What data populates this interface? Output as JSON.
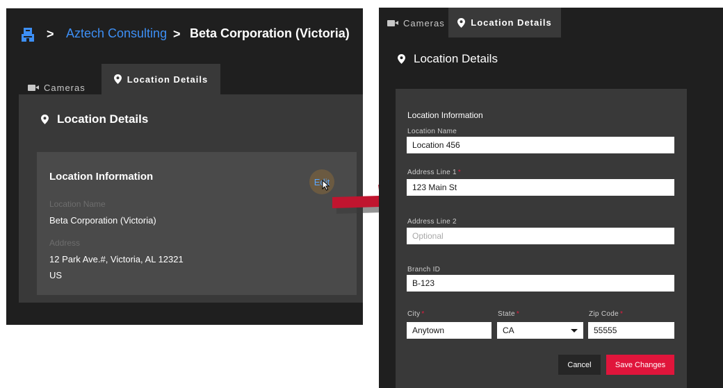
{
  "left": {
    "breadcrumb": {
      "org_icon": "building-icon",
      "separator": ">",
      "parent": "Aztech Consulting",
      "current": "Beta Corporation (Victoria)"
    },
    "tabs": [
      {
        "label": "Cameras",
        "icon": "camera-icon",
        "active": false
      },
      {
        "label": "Location Details",
        "icon": "map-pin-icon",
        "active": true
      }
    ],
    "section_title": "Location Details",
    "card": {
      "title": "Location Information",
      "edit_label": "Edit",
      "location_name_label": "Location Name",
      "location_name_value": "Beta Corporation (Victoria)",
      "address_label": "Address",
      "address_line1": "12 Park Ave.#, Victoria, AL 12321",
      "address_line2": "US"
    }
  },
  "right": {
    "tabs": [
      {
        "label": "Cameras",
        "icon": "camera-icon",
        "active": false
      },
      {
        "label": "Location Details",
        "icon": "map-pin-icon",
        "active": true
      }
    ],
    "section_title": "Location Details",
    "form": {
      "title": "Location Information",
      "location_name": {
        "label": "Location Name",
        "value": "Location 456",
        "required": false
      },
      "address_line1": {
        "label": "Address Line 1",
        "value": "123 Main St",
        "required": true
      },
      "address_line2": {
        "label": "Address Line 2",
        "value": "",
        "placeholder": "Optional",
        "required": false
      },
      "branch_id": {
        "label": "Branch ID",
        "value": "B-123",
        "required": false
      },
      "city": {
        "label": "City",
        "value": "Anytown",
        "required": true
      },
      "state": {
        "label": "State",
        "value": "CA",
        "required": true
      },
      "zip": {
        "label": "Zip Code",
        "value": "55555",
        "required": true
      },
      "required_marker": "*",
      "cancel_label": "Cancel",
      "save_label": "Save Changes"
    }
  },
  "colors": {
    "panel_bg": "#1f1f1f",
    "surface": "#393939",
    "card": "#4a4a4a",
    "link": "#3d8ff5",
    "primary": "#e0153b",
    "arrow": "#c0152f"
  }
}
